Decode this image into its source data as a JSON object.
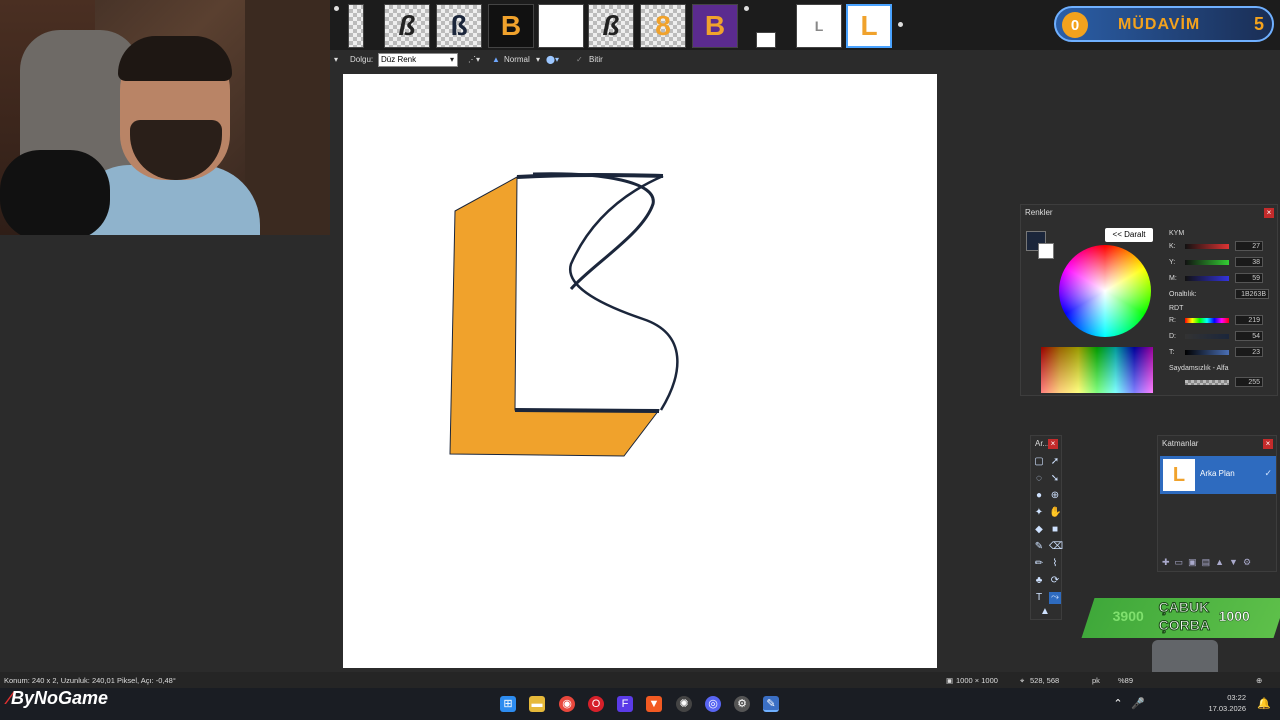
{
  "app": {
    "toolbar": {
      "fill_label": "Dolgu:",
      "fill_value": "Düz Renk",
      "blend_mode": "Normal",
      "finish_label": "Bitir"
    },
    "colors_panel": {
      "title": "Renkler",
      "collapse_label": "<< Daralt",
      "mode_label": "KYM",
      "r_label": "K:",
      "g_label": "Y:",
      "b_label": "M:",
      "r_value": "27",
      "g_value": "38",
      "b_value": "59",
      "hex_label": "Onaltılık:",
      "hex_value": "1B263B",
      "hsv_label": "RDT",
      "h_label": "R:",
      "s_label": "D:",
      "v_label": "T:",
      "h_value": "219",
      "s_value": "54",
      "v_value": "23",
      "alpha_label": "Saydamsızlık - Alfa",
      "alpha_value": "255",
      "primary_color": "#1b263b",
      "secondary_color": "#ffffff"
    },
    "tools_panel": {
      "title": "Ar..."
    },
    "layers_panel": {
      "title": "Katmanlar",
      "layers": [
        {
          "name": "Arka Plan",
          "visible": true
        }
      ]
    },
    "status": {
      "left": "Konum: 240 x 2, Uzunluk: 240,01 Piksel, Açı: -0,48°",
      "size": "1000 × 1000",
      "cursor": "528, 568",
      "unit": "pk",
      "zoom": "%89"
    }
  },
  "overlay": {
    "badge": {
      "count": "0",
      "label": "MÜDAVİM",
      "level": "5"
    },
    "promo": {
      "num1": "3900",
      "line1": "ÇABUK",
      "line2": "ÇORBA",
      "num2": "1000"
    },
    "brand": "ByNoGame"
  },
  "taskbar": {
    "time": "03:22",
    "date": "17.03.2026"
  },
  "colors": {
    "accent_orange": "#f0a22c",
    "stroke_navy": "#1b263b",
    "selection_blue": "#2e6bbf"
  }
}
